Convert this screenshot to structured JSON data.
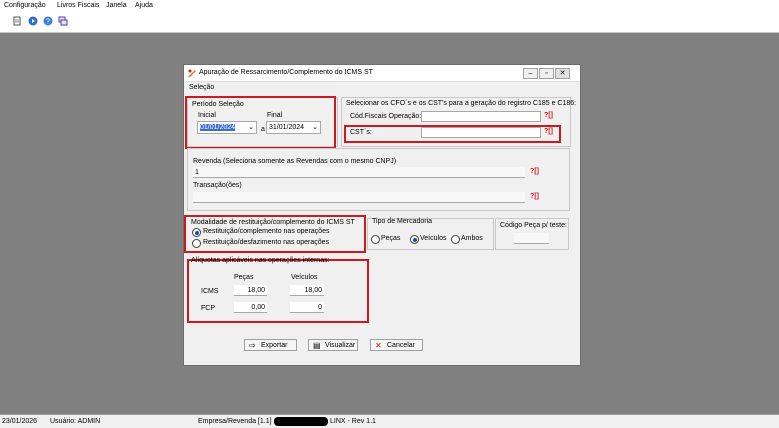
{
  "menu": [
    "Configuração",
    "Livros Fiscais",
    "Janela",
    "Ajuda"
  ],
  "window": {
    "title": "Apuração de Ressarcimento/Complemento do ICMS ST",
    "menu_label": "Seleção"
  },
  "periodo": {
    "label": "Período Seleção",
    "inicial_label": "Inicial",
    "inicial_value": "01/01/2024",
    "a_label": "a",
    "final_label": "Final",
    "final_value": "31/01/2024"
  },
  "cfo": {
    "label": "Selecionar os CFO´s e os CST's para a geração do registro C185 e C186:",
    "cod_label": "Cód.Fiscais Operação:",
    "cst_label": "CST´s:",
    "lookup": "?[]"
  },
  "revenda": {
    "label": "Revenda (Seleciona somente as Revendas com o mesmo CNPJ)",
    "value": "1",
    "transacao_label": "Transação(ões)"
  },
  "modalidade": {
    "label": "Modalidade de restituição/complemento do ICMS ST",
    "opt1": "Restituição/complemento nas operações",
    "opt2": "Restituição/desfazimento nas operações"
  },
  "tipo": {
    "label": "Tipo de Mercadoria",
    "opt1": "Peças",
    "opt2": "Veículos",
    "opt3": "Ambos"
  },
  "codigo": {
    "label": "Código Peça p/ teste:"
  },
  "aliquotas": {
    "label": "Alíquotas aplicáveis nas operações internas:",
    "col1": "Peças",
    "col2": "Veículos",
    "row1": "ICMS",
    "row2": "FCP",
    "icms_pecas": "18,00",
    "icms_veiculos": "18,00",
    "fcp_pecas": "0,00",
    "fcp_veiculos": "0"
  },
  "buttons": {
    "exportar": "Exportar",
    "visualizar": "Visualizar",
    "cancelar": "Cancelar"
  },
  "status": {
    "date": "23/01/2026",
    "user": "Usuário: ADMIN",
    "empresa": "Empresa/Revenda [1.1]",
    "version": "LINX - Rev 1.1"
  },
  "colors": {
    "highlight_red": "#d01820",
    "radio_blue": "#1a4fa0"
  },
  "icons": [
    "page-icon",
    "play-icon",
    "help-icon",
    "window-icon",
    "app-icon",
    "minimize-icon",
    "maximize-icon",
    "close-icon",
    "export-icon",
    "print-icon",
    "cancel-icon"
  ]
}
